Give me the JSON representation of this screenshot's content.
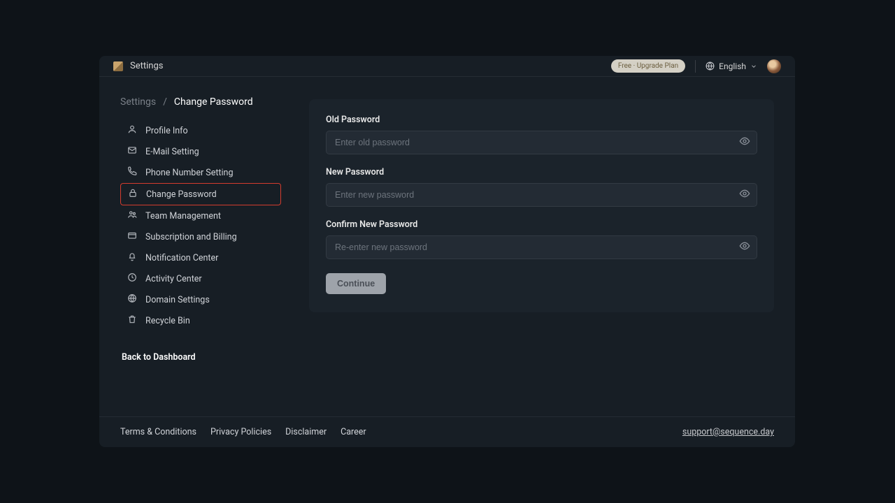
{
  "header": {
    "title": "Settings",
    "upgrade_label": "Free · Upgrade Plan",
    "language": "English"
  },
  "breadcrumb": {
    "root": "Settings",
    "current": "Change Password"
  },
  "sidebar": {
    "items": [
      {
        "icon": "user-icon",
        "label": "Profile Info"
      },
      {
        "icon": "mail-icon",
        "label": "E-Mail Setting"
      },
      {
        "icon": "phone-icon",
        "label": "Phone Number Setting"
      },
      {
        "icon": "lock-icon",
        "label": "Change Password"
      },
      {
        "icon": "team-icon",
        "label": "Team Management"
      },
      {
        "icon": "billing-icon",
        "label": "Subscription and Billing"
      },
      {
        "icon": "bell-icon",
        "label": "Notification Center"
      },
      {
        "icon": "clock-icon",
        "label": "Activity Center"
      },
      {
        "icon": "globe-icon",
        "label": "Domain Settings"
      },
      {
        "icon": "trash-icon",
        "label": "Recycle Bin"
      }
    ],
    "back_label": "Back to Dashboard"
  },
  "form": {
    "old_pw_label": "Old Password",
    "old_pw_placeholder": "Enter old password",
    "new_pw_label": "New Password",
    "new_pw_placeholder": "Enter new password",
    "confirm_pw_label": "Confirm New Password",
    "confirm_pw_placeholder": "Re-enter new password",
    "continue_label": "Continue"
  },
  "footer": {
    "links": [
      "Terms & Conditions",
      "Privacy Policies",
      "Disclaimer",
      "Career"
    ],
    "support_email": "support@sequence.day"
  },
  "colors": {
    "bg_outer": "#0e1318",
    "bg_app": "#171e25",
    "bg_card": "#1b232b",
    "bg_input": "#232b34",
    "accent_highlight": "#d43c2e"
  }
}
